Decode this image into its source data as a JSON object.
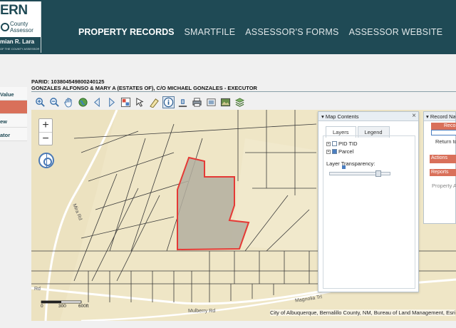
{
  "logo": {
    "title": "ERN",
    "county": "County",
    "assessor": "Assessor",
    "name": "mian R. Lara",
    "office": "OF THE COUNTY ASSESSOR"
  },
  "nav": {
    "items": [
      {
        "label": "PROPERTY RECORDS"
      },
      {
        "label": "SMARTFILE"
      },
      {
        "label": "ASSESSOR'S FORMS"
      },
      {
        "label": "ASSESSOR WEBSITE"
      }
    ]
  },
  "sidebar": {
    "items": [
      {
        "label": "Value"
      },
      {
        "label": ""
      },
      {
        "label": "ew"
      },
      {
        "label": "ator"
      }
    ]
  },
  "record": {
    "parid": "PARID: 103804549800240125",
    "owner": "GONZALES ALFONSO & MARY A (ESTATES OF), C/O MICHAEL GONZALES - EXECUTOR"
  },
  "map": {
    "zoom_in": "+",
    "zoom_out": "−",
    "attribution": "City of Albuquerque, Bernalillo County, NM, Bureau of Land Management, Esri",
    "roads": {
      "mira": "Mira Rd",
      "rd": "Rd",
      "magnolia": "Magnolia Trl",
      "mulberry": "Mulberry Rd"
    },
    "scale": {
      "zero": "0",
      "mid": "300",
      "end": "600ft"
    },
    "parcel_color": "#e53935"
  },
  "map_contents": {
    "title": "Map Contents",
    "close": "×",
    "tabs": [
      {
        "label": "Layers"
      },
      {
        "label": "Legend"
      }
    ],
    "layers": [
      {
        "label": "PID TID",
        "checked": false
      },
      {
        "label": "Parcel",
        "checked": true
      }
    ],
    "transparency_label": "Layer Transparency:"
  },
  "record_nav": {
    "title": "Record Navi",
    "record_btn": "Reco",
    "return_text": "Return to",
    "actions": "Actions",
    "reports": "Reports",
    "property": "Property Al"
  }
}
